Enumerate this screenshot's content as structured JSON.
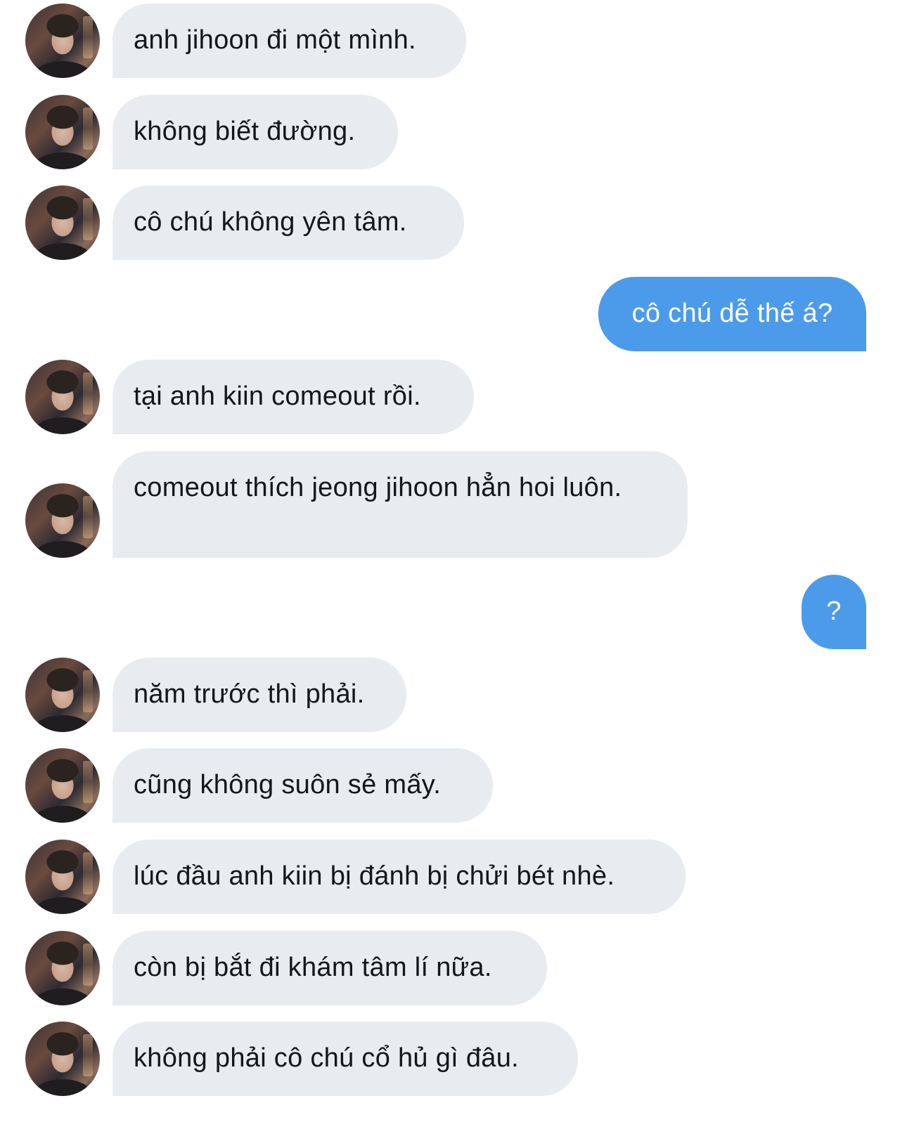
{
  "conversation": {
    "messages": [
      {
        "sender": "them",
        "text": "anh jihoon đi một mình."
      },
      {
        "sender": "them",
        "text": "không biết đường."
      },
      {
        "sender": "them",
        "text": "cô chú không yên tâm."
      },
      {
        "sender": "me",
        "text": "cô chú dễ thế á?"
      },
      {
        "sender": "them",
        "text": "tại anh kiin comeout rồi."
      },
      {
        "sender": "them",
        "text": "comeout thích jeong jihoon hẳn hoi luôn."
      },
      {
        "sender": "me",
        "text": "?"
      },
      {
        "sender": "them",
        "text": "năm trước thì phải."
      },
      {
        "sender": "them",
        "text": "cũng không suôn sẻ mấy."
      },
      {
        "sender": "them",
        "text": "lúc đầu anh kiin bị đánh bị chửi bét nhè."
      },
      {
        "sender": "them",
        "text": "còn bị bắt đi khám tâm lí nữa."
      },
      {
        "sender": "them",
        "text": "không phải cô chú cổ hủ gì đâu."
      }
    ]
  },
  "colors": {
    "incoming_bubble": "#e8ebef",
    "outgoing_bubble": "#4c9bea",
    "incoming_text": "#14171a",
    "outgoing_text": "#ffffff"
  },
  "icons": {
    "avatar": "user-avatar-photo"
  }
}
